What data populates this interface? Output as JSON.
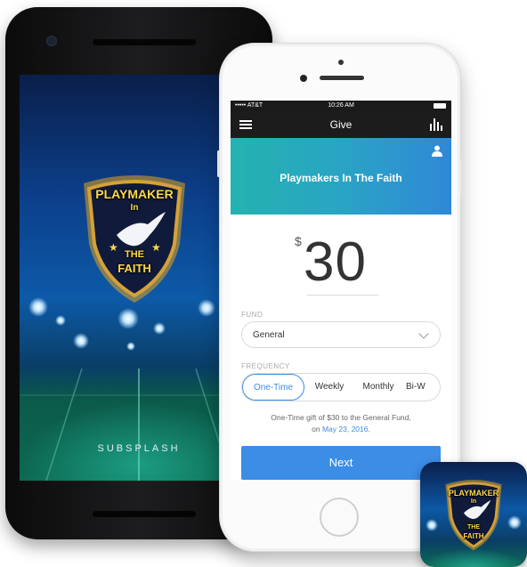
{
  "android": {
    "logo_text": {
      "line1": "PLAYMAKER",
      "line2": "In",
      "line3": "THE",
      "line4": "FAITH"
    },
    "brand": "SUBSPLASH"
  },
  "iphone": {
    "status": {
      "carrier": "••••• AT&T",
      "time": "10:26 AM"
    },
    "nav": {
      "title": "Give",
      "menu_icon": "hamburger-icon",
      "stats_icon": "bar-chart-icon"
    },
    "header": {
      "org_name": "Playmakers In The Faith",
      "profile_icon": "user-icon"
    },
    "amount": {
      "currency": "$",
      "value": "30"
    },
    "fund": {
      "label": "FUND",
      "selected": "General"
    },
    "frequency": {
      "label": "FREQUENCY",
      "options": [
        "One-Time",
        "Weekly",
        "Monthly",
        "Bi-W"
      ],
      "selected": "One-Time"
    },
    "summary": {
      "line1": "One-Time gift of $30 to the General Fund,",
      "on": "on",
      "date": "May 23, 2016",
      "end": "."
    },
    "next_label": "Next"
  },
  "app_icon": {
    "logo_text": {
      "line1": "PLAYMAKER",
      "line2": "In",
      "line3": "THE",
      "line4": "FAITH"
    }
  },
  "colors": {
    "accent": "#3b8de6",
    "header_start": "#23b3b0",
    "header_end": "#2f88d8",
    "logo_gold": "#ffd84a"
  }
}
